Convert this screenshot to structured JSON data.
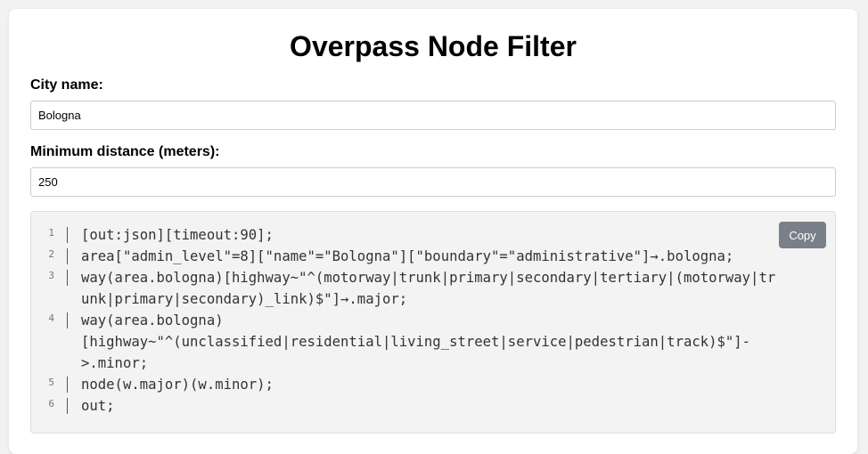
{
  "page": {
    "title": "Overpass Node Filter"
  },
  "form": {
    "city_label": "City name:",
    "city_value": "Bologna",
    "distance_label": "Minimum distance (meters):",
    "distance_value": "250"
  },
  "code": {
    "copy_label": "Copy",
    "lines": [
      {
        "num": "1",
        "text": "[out:json][timeout:90];"
      },
      {
        "num": "2",
        "text": "area[\"admin_level\"=8][\"name\"=\"Bologna\"][\"boundary\"=\"administrative\"]→.bologna;"
      },
      {
        "num": "3",
        "text": "way(area.bologna)[highway~\"^(motorway|trunk|primary|secondary|tertiary|(motorway|trunk|primary|secondary)_link)$\"]→.major;"
      },
      {
        "num": "4",
        "text": "way(area.bologna)\n[highway~\"^(unclassified|residential|living_street|service|pedestrian|track)$\"]-\n>.minor;"
      },
      {
        "num": "5",
        "text": "node(w.major)(w.minor);"
      },
      {
        "num": "6",
        "text": "out;"
      }
    ]
  }
}
